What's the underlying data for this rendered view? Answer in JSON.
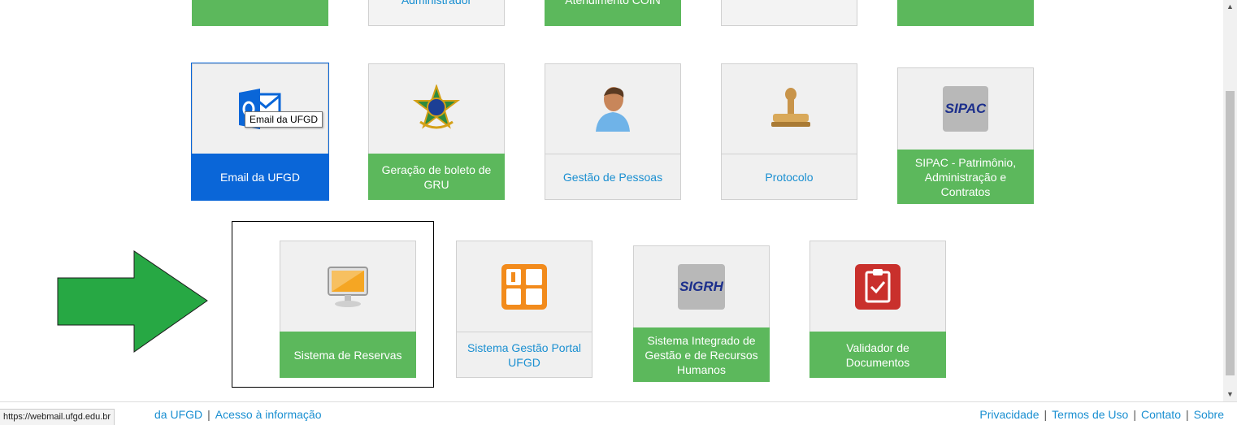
{
  "top_row": [
    {
      "label": "",
      "style": "green"
    },
    {
      "label": "Administrador",
      "style": "grey"
    },
    {
      "label": "Atendimento COIN",
      "style": "green"
    },
    {
      "label": "",
      "style": "grey"
    },
    {
      "label": "",
      "style": "green"
    }
  ],
  "row2": [
    {
      "label": "Email da UFGD",
      "icon": "outlook-mail-icon",
      "style": "blue"
    },
    {
      "label": "Geração de boleto de GRU",
      "icon": "brazil-coat-of-arms-icon",
      "style": "green"
    },
    {
      "label": "Gestão de Pessoas",
      "icon": "person-icon",
      "style": "grey"
    },
    {
      "label": "Protocolo",
      "icon": "rubber-stamp-icon",
      "style": "grey"
    },
    {
      "label": "SIPAC - Patrimônio, Administração e Contratos",
      "icon": "sipac-logo-icon",
      "style": "green",
      "logo_text": "SIPAC"
    }
  ],
  "row3": [
    {
      "label": "Sistema de Reservas",
      "icon": "computer-monitor-icon",
      "style": "green"
    },
    {
      "label": "Sistema Gestão Portal UFGD",
      "icon": "portal-logo-icon",
      "style": "grey"
    },
    {
      "label": "Sistema Integrado de Gestão e de Recursos Humanos",
      "icon": "sigrh-logo-icon",
      "style": "green",
      "logo_text": "SIGRH"
    },
    {
      "label": "Validador de Documentos",
      "icon": "clipboard-check-icon",
      "style": "green"
    }
  ],
  "tooltip": "Email da UFGD",
  "status_url": "https://webmail.ufgd.edu.br",
  "footer": {
    "left_fragment": "da UFGD",
    "left_link2": "Acesso à informação",
    "right_links": [
      "Privacidade",
      "Termos de Uso",
      "Contato",
      "Sobre"
    ]
  }
}
